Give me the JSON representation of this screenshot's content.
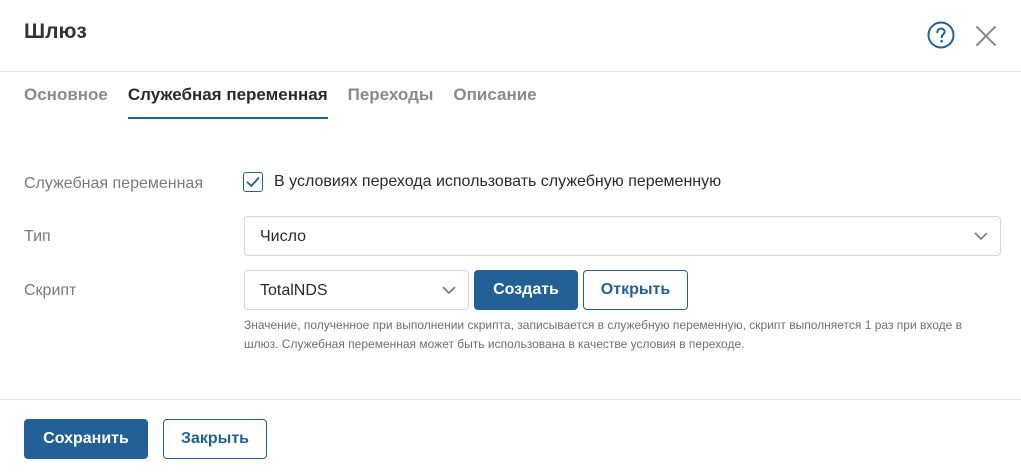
{
  "dialog": {
    "title": "Шлюз"
  },
  "tabs": [
    {
      "label": "Основное",
      "active": false
    },
    {
      "label": "Служебная переменная",
      "active": true
    },
    {
      "label": "Переходы",
      "active": false
    },
    {
      "label": "Описание",
      "active": false
    }
  ],
  "form": {
    "service_variable": {
      "label": "Служебная переменная",
      "checkbox_label": "В условиях перехода использовать служебную переменную",
      "checked": true
    },
    "type": {
      "label": "Тип",
      "value": "Число"
    },
    "script": {
      "label": "Скрипт",
      "value": "TotalNDS",
      "create_label": "Создать",
      "open_label": "Открыть",
      "hint": "Значение, полученное при выполнении скрипта, записывается в служебную переменную, скрипт выполняется 1 раз при входе в шлюз. Служебная переменная может быть использована в качестве условия в переходе."
    }
  },
  "footer": {
    "save_label": "Сохранить",
    "close_label": "Закрыть"
  },
  "colors": {
    "accent": "#226095",
    "border": "#d6d6d6",
    "label": "#7a7a7a"
  },
  "icons": {
    "help": "help-circle-icon",
    "close": "close-icon",
    "check": "check-icon",
    "dropdown": "chevron-down-icon"
  }
}
